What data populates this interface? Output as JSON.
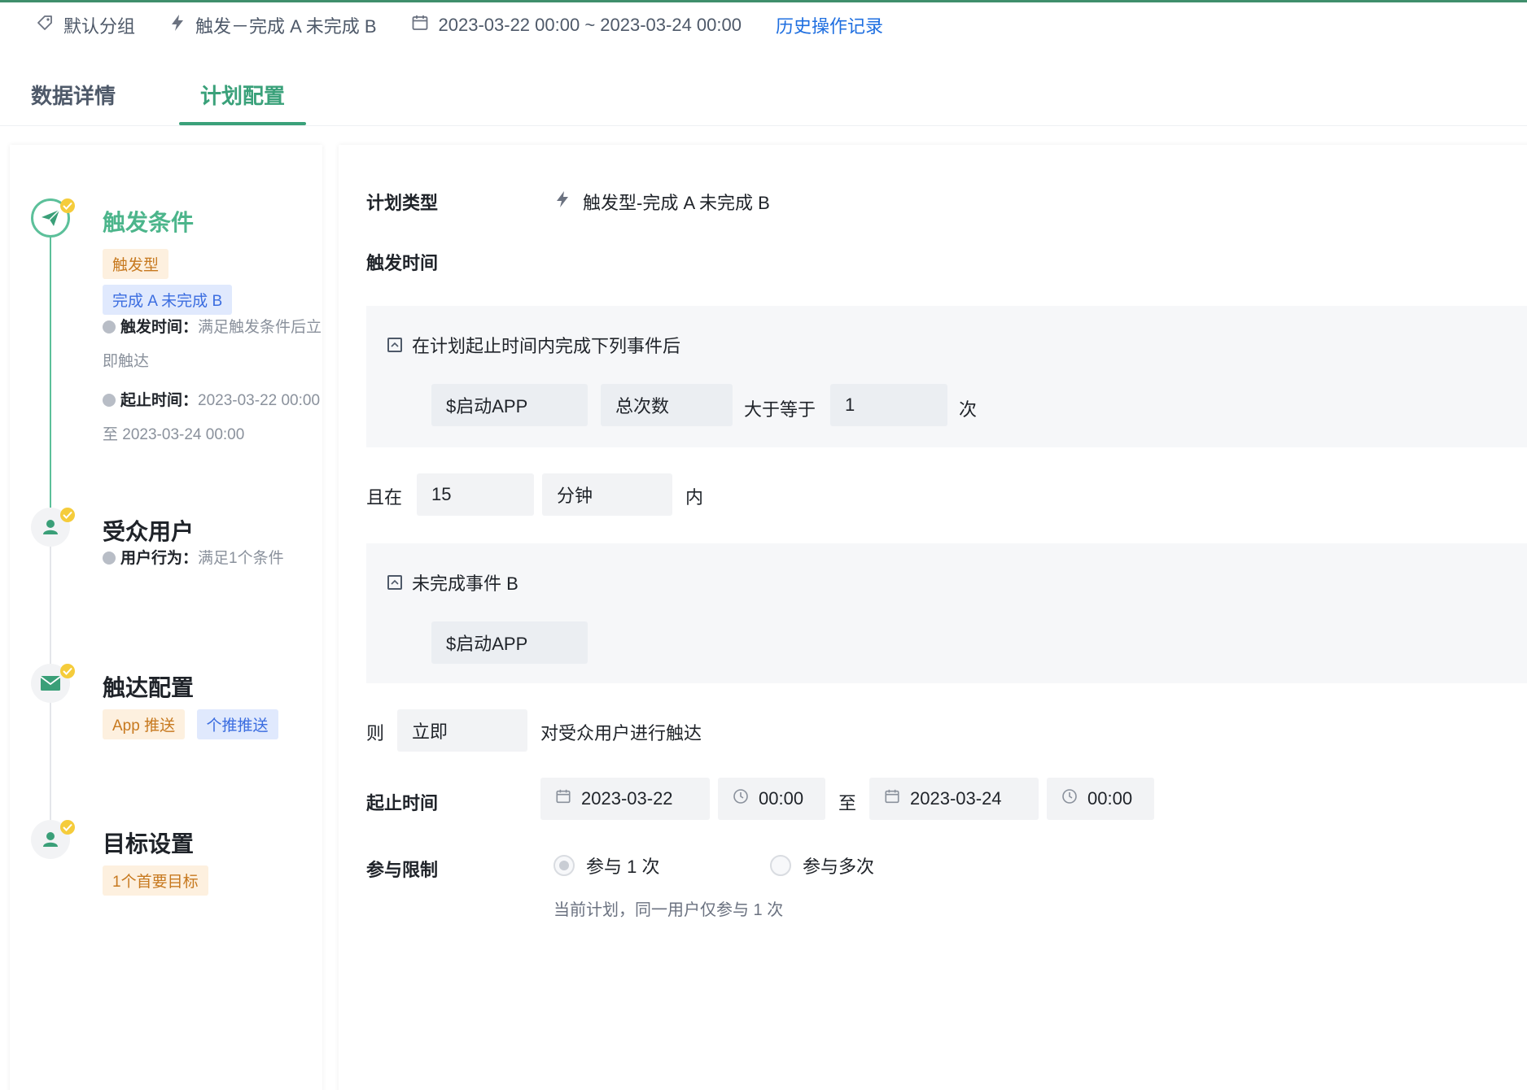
{
  "header": {
    "group": "默认分组",
    "trigger": "触发－完成 A 未完成 B",
    "date_range": "2023-03-22 00:00 ~ 2023-03-24 00:00",
    "history_link": "历史操作记录"
  },
  "tabs": [
    {
      "label": "数据详情",
      "active": false
    },
    {
      "label": "计划配置",
      "active": true
    }
  ],
  "steps": {
    "trigger": {
      "title": "触发条件",
      "tags": [
        "触发型",
        "完成 A 未完成 B"
      ],
      "time_label": "触发时间：",
      "time_value": "满足触发条件后立即触达",
      "period_label": "起止时间：",
      "period_value": "2023-03-22 00:00 至 2023-03-24 00:00"
    },
    "audience": {
      "title": "受众用户",
      "behavior_label": "用户行为：",
      "behavior_value": "满足1个条件"
    },
    "reach": {
      "title": "触达配置",
      "tags": [
        "App 推送",
        "个推推送"
      ]
    },
    "goal": {
      "title": "目标设置",
      "tags": [
        "1个首要目标"
      ]
    }
  },
  "config": {
    "plan_type_label": "计划类型",
    "plan_type_value": "触发型-完成 A 未完成 B",
    "trigger_time_label": "触发时间",
    "section_a": {
      "title": "在计划起止时间内完成下列事件后",
      "event": "$启动APP",
      "metric": "总次数",
      "operator": "大于等于",
      "count": "1",
      "unit": "次"
    },
    "within": {
      "prefix": "且在",
      "value": "15",
      "unit": "分钟",
      "suffix": "内"
    },
    "section_b": {
      "title": "未完成事件 B",
      "event": "$启动APP"
    },
    "then": {
      "prefix": "则",
      "value": "立即",
      "suffix": "对受众用户进行触达"
    },
    "period": {
      "label": "起止时间",
      "start_date": "2023-03-22",
      "start_time": "00:00",
      "separator": "至",
      "end_date": "2023-03-24",
      "end_time": "00:00"
    },
    "limit": {
      "label": "参与限制",
      "option_once": "参与 1 次",
      "option_multi": "参与多次",
      "hint": "当前计划，同一用户仅参与 1 次"
    }
  },
  "colors": {
    "accent": "#3aa17a",
    "link": "#1f6fe0",
    "tag_orange_bg": "#fdf0df",
    "tag_blue_bg": "#e0e9fd"
  }
}
